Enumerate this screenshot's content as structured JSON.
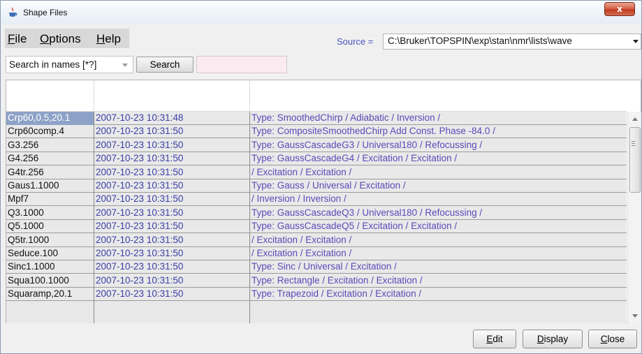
{
  "window": {
    "title": "Shape Files",
    "close_symbol": "x"
  },
  "menu": {
    "items": [
      {
        "mnemonic": "F",
        "rest": "ile"
      },
      {
        "mnemonic": "O",
        "rest": "ptions"
      },
      {
        "mnemonic": "H",
        "rest": "elp"
      }
    ]
  },
  "source": {
    "label": "Source =",
    "value": "C:\\Bruker\\TOPSPIN\\exp\\stan\\nmr\\lists\\wave"
  },
  "search": {
    "mode": "Search in names [*?]",
    "button_label": "Search",
    "query": ""
  },
  "table": {
    "selected_index": 0,
    "rows": [
      {
        "name": "Crp60,0.5,20.1",
        "date": "2007-10-23 10:31:48",
        "desc": "Type: SmoothedChirp / Adiabatic / Inversion /"
      },
      {
        "name": "Crp60comp.4",
        "date": "2007-10-23 10:31:50",
        "desc": "Type: CompositeSmoothedChirp Add Const. Phase -84.0 /"
      },
      {
        "name": "G3.256",
        "date": "2007-10-23 10:31:50",
        "desc": "Type: GaussCascadeG3 / Universal180 / Refocussing /"
      },
      {
        "name": "G4.256",
        "date": "2007-10-23 10:31:50",
        "desc": "Type: GaussCascadeG4 / Excitation / Excitation /"
      },
      {
        "name": "G4tr.256",
        "date": "2007-10-23 10:31:50",
        "desc": "/ Excitation / Excitation /"
      },
      {
        "name": "Gaus1.1000",
        "date": "2007-10-23 10:31:50",
        "desc": "Type: Gauss / Universal / Excitation /"
      },
      {
        "name": "Mpf7",
        "date": "2007-10-23 10:31:50",
        "desc": "/ Inversion / Inversion /"
      },
      {
        "name": "Q3.1000",
        "date": "2007-10-23 10:31:50",
        "desc": "Type: GaussCascadeQ3 / Universal180 / Refocussing /"
      },
      {
        "name": "Q5.1000",
        "date": "2007-10-23 10:31:50",
        "desc": "Type: GaussCascadeQ5 / Excitation / Excitation /"
      },
      {
        "name": "Q5tr.1000",
        "date": "2007-10-23 10:31:50",
        "desc": "/ Excitation / Excitation /"
      },
      {
        "name": "Seduce.100",
        "date": "2007-10-23 10:31:50",
        "desc": "/ Excitation / Excitation /"
      },
      {
        "name": "Sinc1.1000",
        "date": "2007-10-23 10:31:50",
        "desc": "Type: Sinc / Universal / Excitation /"
      },
      {
        "name": "Squa100.1000",
        "date": "2007-10-23 10:31:50",
        "desc": "Type: Rectangle / Excitation / Excitation /"
      },
      {
        "name": "Squaramp,20.1",
        "date": "2007-10-23 10:31:50",
        "desc": "Type: Trapezoid / Excitation / Excitation /"
      }
    ]
  },
  "buttons": {
    "edit": {
      "mnemonic": "E",
      "rest": "dit"
    },
    "display": {
      "mnemonic": "D",
      "rest": "isplay"
    },
    "close": {
      "mnemonic": "C",
      "rest": "lose"
    }
  }
}
